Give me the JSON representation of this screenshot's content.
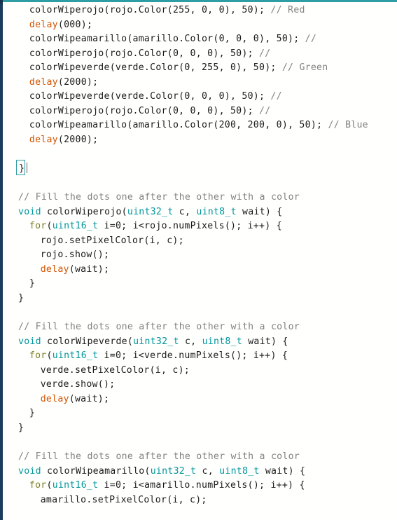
{
  "window": {
    "kind": "arduino-ide-code-editor",
    "accent_color": "#2f9da4",
    "gutter_color": "#1b3b5f",
    "background_color": "#fffffe"
  },
  "theme": {
    "default_text": "#1b1b1b",
    "keyword_type": "#00979c",
    "keyword_control": "#7e7e22",
    "builtin_function": "#d35400",
    "comment": "#828282"
  },
  "code": {
    "language": "arduino-c",
    "lines": [
      {
        "n": 1,
        "indent": 2,
        "tokens": [
          {
            "t": "colorWiperojo(rojo.Color(255, 0, 0), 50); ",
            "c": "plain"
          },
          {
            "t": "// Red",
            "c": "comment"
          }
        ]
      },
      {
        "n": 2,
        "indent": 2,
        "tokens": [
          {
            "t": "delay",
            "c": "fn"
          },
          {
            "t": "(000);",
            "c": "plain"
          }
        ]
      },
      {
        "n": 3,
        "indent": 2,
        "tokens": [
          {
            "t": "colorWipeamarillo(amarillo.Color(0, 0, 0), 50); ",
            "c": "plain"
          },
          {
            "t": "//",
            "c": "comment"
          }
        ]
      },
      {
        "n": 4,
        "indent": 2,
        "tokens": [
          {
            "t": "colorWiperojo(rojo.Color(0, 0, 0), 50); ",
            "c": "plain"
          },
          {
            "t": "//",
            "c": "comment"
          }
        ]
      },
      {
        "n": 5,
        "indent": 2,
        "tokens": [
          {
            "t": "colorWipeverde(verde.Color(0, 255, 0), 50); ",
            "c": "plain"
          },
          {
            "t": "// Green",
            "c": "comment"
          }
        ]
      },
      {
        "n": 6,
        "indent": 2,
        "tokens": [
          {
            "t": "delay",
            "c": "fn"
          },
          {
            "t": "(2000);",
            "c": "plain"
          }
        ]
      },
      {
        "n": 7,
        "indent": 2,
        "tokens": [
          {
            "t": "colorWipeverde(verde.Color(0, 0, 0), 50); ",
            "c": "plain"
          },
          {
            "t": "//",
            "c": "comment"
          }
        ]
      },
      {
        "n": 8,
        "indent": 2,
        "tokens": [
          {
            "t": "colorWiperojo(rojo.Color(0, 0, 0), 50); ",
            "c": "plain"
          },
          {
            "t": "//",
            "c": "comment"
          }
        ]
      },
      {
        "n": 9,
        "indent": 2,
        "tokens": [
          {
            "t": "colorWipeamarillo(amarillo.Color(200, 200, 0), 50); ",
            "c": "plain"
          },
          {
            "t": "// Blue",
            "c": "comment"
          }
        ]
      },
      {
        "n": 10,
        "indent": 2,
        "tokens": [
          {
            "t": "delay",
            "c": "fn"
          },
          {
            "t": "(2000);",
            "c": "plain"
          }
        ]
      },
      {
        "n": 11,
        "indent": 0,
        "blank": true,
        "tokens": []
      },
      {
        "n": 12,
        "indent": 0,
        "brace_match": true,
        "tokens": [
          {
            "t": "}",
            "c": "plain"
          }
        ]
      },
      {
        "n": 13,
        "indent": 0,
        "blank": true,
        "tokens": []
      },
      {
        "n": 14,
        "indent": 0,
        "tokens": [
          {
            "t": "// Fill the dots one after the other with a color",
            "c": "comment"
          }
        ]
      },
      {
        "n": 15,
        "indent": 0,
        "tokens": [
          {
            "t": "void",
            "c": "kw"
          },
          {
            "t": " colorWiperojo(",
            "c": "plain"
          },
          {
            "t": "uint32_t",
            "c": "kw"
          },
          {
            "t": " c, ",
            "c": "plain"
          },
          {
            "t": "uint8_t",
            "c": "kw"
          },
          {
            "t": " wait) {",
            "c": "plain"
          }
        ]
      },
      {
        "n": 16,
        "indent": 2,
        "tokens": [
          {
            "t": "for",
            "c": "ctrl"
          },
          {
            "t": "(",
            "c": "plain"
          },
          {
            "t": "uint16_t",
            "c": "kw"
          },
          {
            "t": " i=0; i<rojo.numPixels(); i++) {",
            "c": "plain"
          }
        ]
      },
      {
        "n": 17,
        "indent": 4,
        "tokens": [
          {
            "t": "rojo.setPixelColor(i, c);",
            "c": "plain"
          }
        ]
      },
      {
        "n": 18,
        "indent": 4,
        "tokens": [
          {
            "t": "rojo.show();",
            "c": "plain"
          }
        ]
      },
      {
        "n": 19,
        "indent": 4,
        "tokens": [
          {
            "t": "delay",
            "c": "fn"
          },
          {
            "t": "(wait);",
            "c": "plain"
          }
        ]
      },
      {
        "n": 20,
        "indent": 2,
        "tokens": [
          {
            "t": "}",
            "c": "plain"
          }
        ]
      },
      {
        "n": 21,
        "indent": 0,
        "tokens": [
          {
            "t": "}",
            "c": "plain"
          }
        ]
      },
      {
        "n": 22,
        "indent": 0,
        "blank": true,
        "tokens": []
      },
      {
        "n": 23,
        "indent": 0,
        "tokens": [
          {
            "t": "// Fill the dots one after the other with a color",
            "c": "comment"
          }
        ]
      },
      {
        "n": 24,
        "indent": 0,
        "tokens": [
          {
            "t": "void",
            "c": "kw"
          },
          {
            "t": " colorWipeverde(",
            "c": "plain"
          },
          {
            "t": "uint32_t",
            "c": "kw"
          },
          {
            "t": " c, ",
            "c": "plain"
          },
          {
            "t": "uint8_t",
            "c": "kw"
          },
          {
            "t": " wait) {",
            "c": "plain"
          }
        ]
      },
      {
        "n": 25,
        "indent": 2,
        "tokens": [
          {
            "t": "for",
            "c": "ctrl"
          },
          {
            "t": "(",
            "c": "plain"
          },
          {
            "t": "uint16_t",
            "c": "kw"
          },
          {
            "t": " i=0; i<verde.numPixels(); i++) {",
            "c": "plain"
          }
        ]
      },
      {
        "n": 26,
        "indent": 4,
        "tokens": [
          {
            "t": "verde.setPixelColor(i, c);",
            "c": "plain"
          }
        ]
      },
      {
        "n": 27,
        "indent": 4,
        "tokens": [
          {
            "t": "verde.show();",
            "c": "plain"
          }
        ]
      },
      {
        "n": 28,
        "indent": 4,
        "tokens": [
          {
            "t": "delay",
            "c": "fn"
          },
          {
            "t": "(wait);",
            "c": "plain"
          }
        ]
      },
      {
        "n": 29,
        "indent": 2,
        "tokens": [
          {
            "t": "}",
            "c": "plain"
          }
        ]
      },
      {
        "n": 30,
        "indent": 0,
        "tokens": [
          {
            "t": "}",
            "c": "plain"
          }
        ]
      },
      {
        "n": 31,
        "indent": 0,
        "blank": true,
        "tokens": []
      },
      {
        "n": 32,
        "indent": 0,
        "tokens": [
          {
            "t": "// Fill the dots one after the other with a color",
            "c": "comment"
          }
        ]
      },
      {
        "n": 33,
        "indent": 0,
        "tokens": [
          {
            "t": "void",
            "c": "kw"
          },
          {
            "t": " colorWipeamarillo(",
            "c": "plain"
          },
          {
            "t": "uint32_t",
            "c": "kw"
          },
          {
            "t": " c, ",
            "c": "plain"
          },
          {
            "t": "uint8_t",
            "c": "kw"
          },
          {
            "t": " wait) {",
            "c": "plain"
          }
        ]
      },
      {
        "n": 34,
        "indent": 2,
        "tokens": [
          {
            "t": "for",
            "c": "ctrl"
          },
          {
            "t": "(",
            "c": "plain"
          },
          {
            "t": "uint16_t",
            "c": "kw"
          },
          {
            "t": " i=0; i<amarillo.numPixels(); i++) {",
            "c": "plain"
          }
        ]
      },
      {
        "n": 35,
        "indent": 4,
        "tokens": [
          {
            "t": "amarillo.setPixelColor(i, c);",
            "c": "plain"
          }
        ]
      }
    ]
  }
}
